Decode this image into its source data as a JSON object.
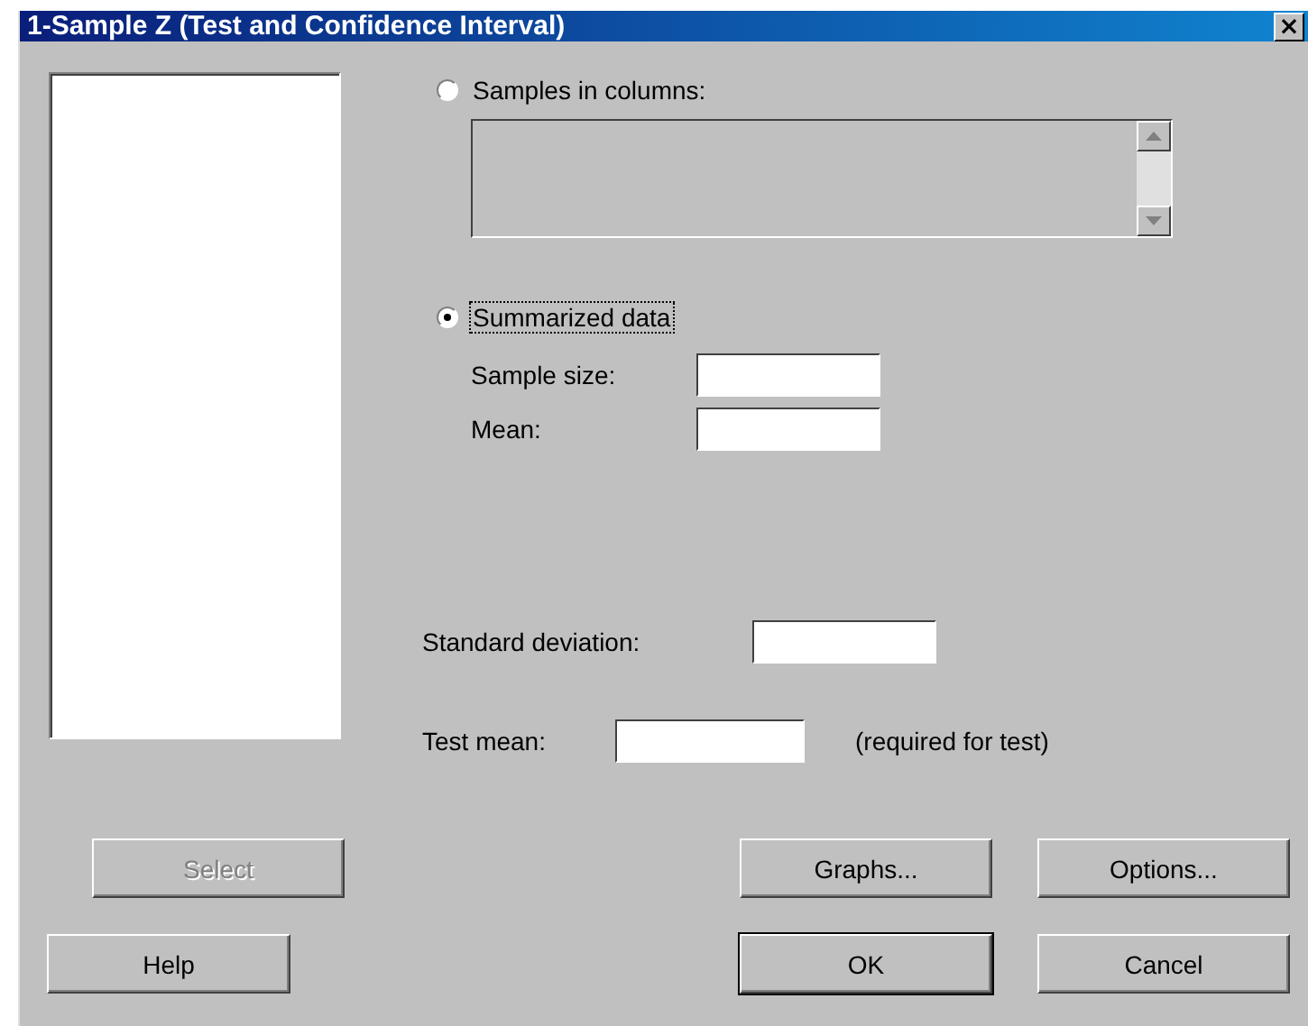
{
  "window": {
    "title": "1-Sample Z (Test and Confidence Interval)",
    "close": "×"
  },
  "source_options": [
    {
      "kind": "columns",
      "label": "Samples in columns:",
      "selected": false
    },
    {
      "kind": "summary",
      "label": "Summarized data",
      "selected": true,
      "fields": [
        {
          "label": "Sample size:"
        },
        {
          "label": "Mean:"
        }
      ]
    }
  ],
  "standard_deviation": {
    "label": "Standard deviation:"
  },
  "test_mean": {
    "label": "Test mean:",
    "note": "(required for test)"
  },
  "button_rows": [
    {
      "left": [
        {
          "label": "Select",
          "disabled": true,
          "default": false
        }
      ],
      "right": [
        {
          "label": "Graphs...",
          "disabled": false,
          "default": false
        },
        {
          "label": "Options...",
          "disabled": false,
          "default": false
        }
      ]
    },
    {
      "left": [
        {
          "label": "Help",
          "disabled": false,
          "default": false
        }
      ],
      "right": [
        {
          "label": "OK",
          "disabled": false,
          "default": true
        },
        {
          "label": "Cancel",
          "disabled": false,
          "default": false
        }
      ]
    }
  ]
}
